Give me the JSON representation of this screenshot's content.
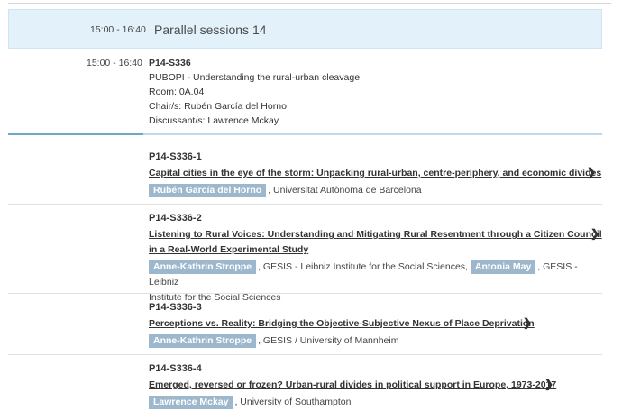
{
  "session": {
    "time": "15:00 - 16:40",
    "title": "Parallel sessions 14"
  },
  "panel": {
    "time": "15:00 - 16:40",
    "code": "P14-S336",
    "name": "PUBOPI - Understanding the rural-urban cleavage",
    "room": "Room: 0A.04",
    "chair": "Chair/s: Rubén García del Horno",
    "discussant": "Discussant/s: Lawrence Mckay"
  },
  "papers": [
    {
      "code": "P14-S336-1",
      "title": "Capital cities in the eye of the storm: Unpacking rural-urban, centre-periphery, and economic divides",
      "author1": "Rubén García del Horno",
      "affil1": ", Universitat Autònoma de Barcelona"
    },
    {
      "code": "P14-S336-2",
      "title_line1": "Listening to Rural Voices: Understanding and Mitigating Rural Resentment through a Citizen Council",
      "title_line2": "in a Real-World Experimental Study",
      "author1": "Anne-Kathrin Stroppe",
      "affil1": ", GESIS - Leibniz Institute for the Social Sciences, ",
      "author2": "Antonia May",
      "affil2_line1": ", GESIS - Leibniz",
      "affil2_line2": "Institute for the Social Sciences"
    },
    {
      "code": "P14-S336-3",
      "title": "Perceptions vs. Reality: Bridging the Objective-Subjective Nexus of Place Deprivation",
      "author1": "Anne-Kathrin Stroppe",
      "affil1": ", GESIS / University of Mannheim"
    },
    {
      "code": "P14-S336-4",
      "title": "Emerged, reversed or frozen? Urban-rural divides in political support in Europe, 1973-2017",
      "author1": "Lawrence Mckay",
      "affil1": ", University of Southampton"
    }
  ],
  "chevron": "❯",
  "colors": {
    "header_bg": "#e3f1fb",
    "author_badge": "#9db7cc",
    "accent_rule": "#6fa7c9"
  }
}
